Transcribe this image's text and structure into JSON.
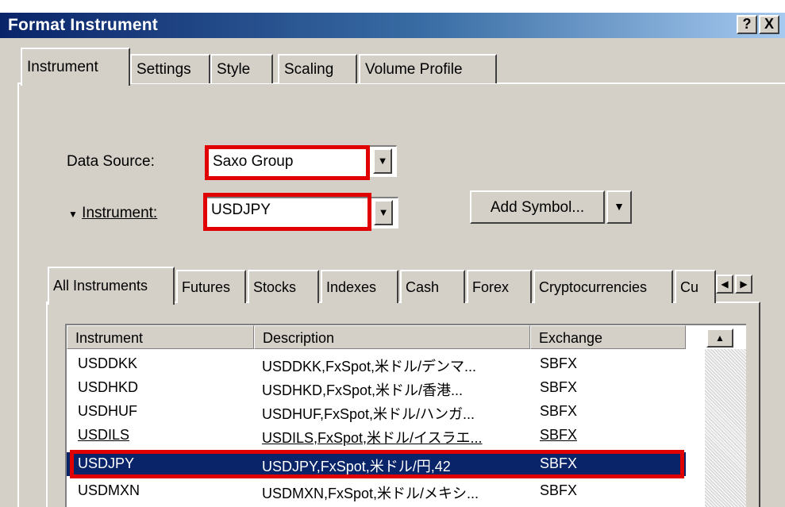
{
  "window": {
    "title": "Format Instrument",
    "help_btn": "?",
    "close_btn": "X"
  },
  "tabs": [
    {
      "label": "Instrument",
      "active": true
    },
    {
      "label": "Settings",
      "active": false
    },
    {
      "label": "Style",
      "active": false
    },
    {
      "label": "Scaling",
      "active": false
    },
    {
      "label": "Volume Profile",
      "active": false
    }
  ],
  "form": {
    "data_source_label": "Data Source:",
    "data_source_value": "Saxo Group",
    "instrument_label": "Instrument:",
    "instrument_value": "USDJPY",
    "add_symbol_label": "Add Symbol..."
  },
  "subtabs": [
    {
      "label": "All Instruments",
      "active": true
    },
    {
      "label": "Futures"
    },
    {
      "label": "Stocks"
    },
    {
      "label": "Indexes"
    },
    {
      "label": "Cash"
    },
    {
      "label": "Forex"
    },
    {
      "label": "Cryptocurrencies"
    },
    {
      "label": "Cu"
    }
  ],
  "table": {
    "columns": [
      "Instrument",
      "Description",
      "Exchange"
    ],
    "rows": [
      {
        "instrument": "USDDKK",
        "description": "USDDKK,FxSpot,米ドル/デンマ...",
        "exchange": "SBFX"
      },
      {
        "instrument": "USDHKD",
        "description": "USDHKD,FxSpot,米ドル/香港...",
        "exchange": "SBFX"
      },
      {
        "instrument": "USDHUF",
        "description": "USDHUF,FxSpot,米ドル/ハンガ...",
        "exchange": "SBFX"
      },
      {
        "instrument": "USDILS",
        "description": "USDILS,FxSpot,米ドル/イスラエ...",
        "exchange": "SBFX"
      },
      {
        "instrument": "USDJPY",
        "description": "USDJPY,FxSpot,米ドル/円,42",
        "exchange": "SBFX",
        "selected": true
      },
      {
        "instrument": "USDMXN",
        "description": "USDMXN,FxSpot,米ドル/メキシ...",
        "exchange": "SBFX"
      }
    ]
  },
  "icons": {
    "dropdown": "triangle-down-icon",
    "scroll_left": "triangle-left-icon",
    "scroll_right": "triangle-right-icon",
    "scroll_up": "triangle-up-icon"
  },
  "colors": {
    "highlight": "#e00000",
    "selection": "#0a246a",
    "dialog_bg": "#d4d0c8"
  }
}
